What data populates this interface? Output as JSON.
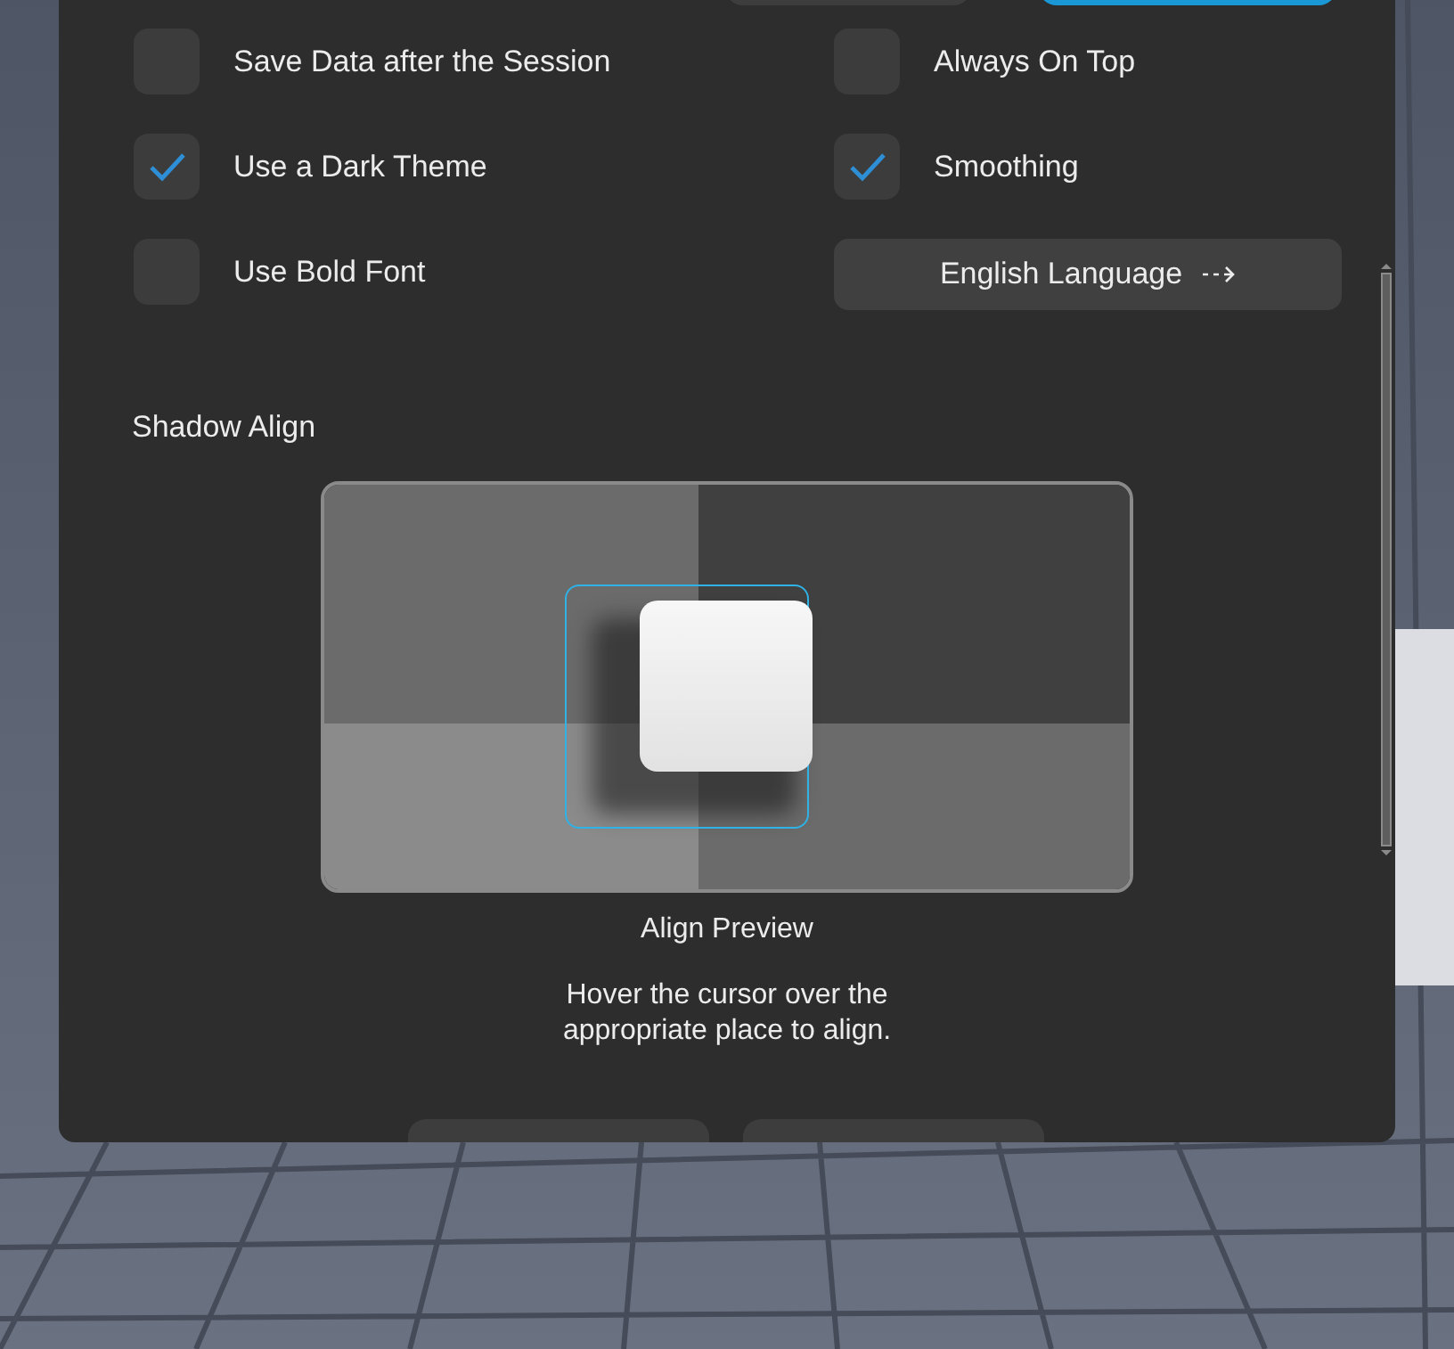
{
  "options": [
    {
      "label": "Save Data after the Session",
      "checked": false
    },
    {
      "label": "Always On Top",
      "checked": false
    },
    {
      "label": "Use a Dark Theme",
      "checked": true
    },
    {
      "label": "Smoothing",
      "checked": true
    },
    {
      "label": "Use Bold Font",
      "checked": false
    }
  ],
  "language_button": {
    "label": "English Language"
  },
  "shadow_align": {
    "title": "Shadow Align",
    "caption": "Align Preview",
    "hint": "Hover the cursor over the\nappropriate place to align."
  }
}
